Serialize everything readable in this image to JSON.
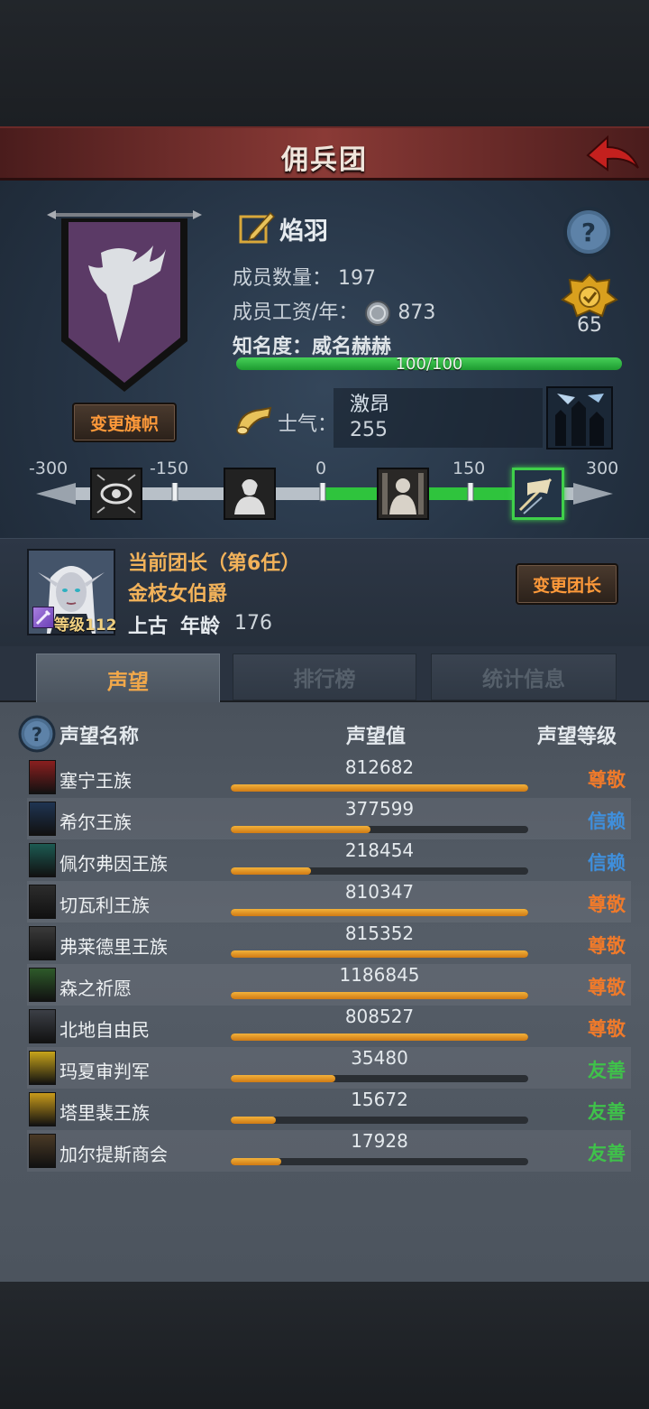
{
  "header": {
    "title": "佣兵团"
  },
  "guild": {
    "name": "焰羽",
    "members_label": "成员数量：",
    "members": "197",
    "wage_label": "成员工资/年：",
    "wage": "873",
    "fame_label": "知名度：威名赫赫",
    "fame_progress_text": "100/100",
    "fame_progress": 1.0,
    "medal_value": "65",
    "change_banner_label": "变更旗帜",
    "banner_color": "#5b3a66"
  },
  "morale": {
    "label": "士气：",
    "state": "激昂",
    "value": "255",
    "track_labels": [
      "-300",
      "-150",
      "0",
      "150",
      "300"
    ],
    "track_min": -300,
    "track_max": 300,
    "current": 255
  },
  "leader": {
    "title": "当前团长（第6任）",
    "name": "金枝女伯爵",
    "race": "上古",
    "age_label": "年龄",
    "age": "176",
    "level_text": "等级112",
    "change_label": "变更团长"
  },
  "tabs": [
    {
      "label": "声望",
      "active": true
    },
    {
      "label": "排行榜",
      "active": false
    },
    {
      "label": "统计信息",
      "active": false
    }
  ],
  "reputation": {
    "headers": {
      "name": "声望名称",
      "value": "声望值",
      "level": "声望等级"
    },
    "level_colors": {
      "尊敬": "#f07a2a",
      "信赖": "#3f8fdc",
      "友善": "#3fc24a"
    },
    "rows": [
      {
        "name": "塞宁王族",
        "value": "812682",
        "progress": 1.0,
        "level": "尊敬",
        "icon_color": "#8a1f1f"
      },
      {
        "name": "希尔王族",
        "value": "377599",
        "progress": 0.47,
        "level": "信赖",
        "icon_color": "#1f3552"
      },
      {
        "name": "佩尔弗因王族",
        "value": "218454",
        "progress": 0.27,
        "level": "信赖",
        "icon_color": "#1c5a52"
      },
      {
        "name": "切瓦利王族",
        "value": "810347",
        "progress": 1.0,
        "level": "尊敬",
        "icon_color": "#2c2c2c"
      },
      {
        "name": "弗莱德里王族",
        "value": "815352",
        "progress": 1.0,
        "level": "尊敬",
        "icon_color": "#3a3a3a"
      },
      {
        "name": "森之祈愿",
        "value": "1186845",
        "progress": 1.0,
        "level": "尊敬",
        "icon_color": "#2e5a2a"
      },
      {
        "name": "北地自由民",
        "value": "808527",
        "progress": 1.0,
        "level": "尊敬",
        "icon_color": "#3c3f46"
      },
      {
        "name": "玛夏审判军",
        "value": "35480",
        "progress": 0.35,
        "level": "友善",
        "icon_color": "#c8a41a"
      },
      {
        "name": "塔里裴王族",
        "value": "15672",
        "progress": 0.15,
        "level": "友善",
        "icon_color": "#c89a1a"
      },
      {
        "name": "加尔提斯商会",
        "value": "17928",
        "progress": 0.17,
        "level": "友善",
        "icon_color": "#4a3a26"
      }
    ]
  }
}
